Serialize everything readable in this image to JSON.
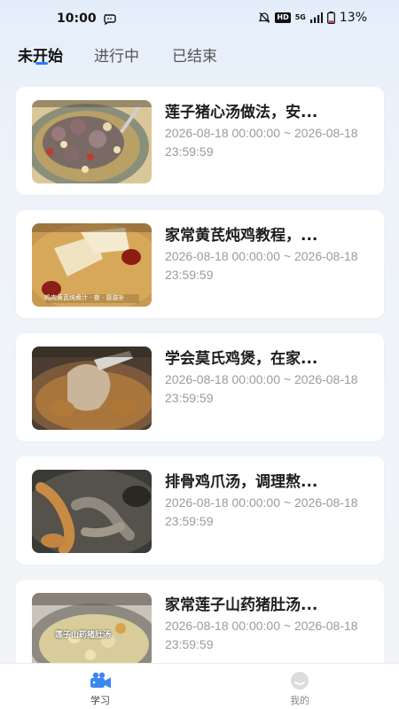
{
  "status_bar": {
    "time": "10:00",
    "battery_percent": "13%",
    "network": "5G",
    "hd_label": "HD"
  },
  "tabs": [
    {
      "label": "未开始",
      "active": true
    },
    {
      "label": "进行中",
      "active": false
    },
    {
      "label": "已结束",
      "active": false
    }
  ],
  "courses": [
    {
      "title": "莲子猪心汤做法，安...",
      "time": "2026-08-18 00:00:00 ~ 2026-08-18 23:59:59",
      "thumb_icon": "lotus-pork-heart-soup-image"
    },
    {
      "title": "家常黄芪炖鸡教程，...",
      "time": "2026-08-18 00:00:00 ~ 2026-08-18 23:59:59",
      "thumb_icon": "astragalus-chicken-image",
      "thumb_caption": "鸡肉黄芪炖煮汁 · 夜 · 感滋补"
    },
    {
      "title": "学会莫氏鸡煲，在家...",
      "time": "2026-08-18 00:00:00 ~ 2026-08-18 23:59:59",
      "thumb_icon": "chicken-pot-image"
    },
    {
      "title": "排骨鸡爪汤，调理熬...",
      "time": "2026-08-18 00:00:00 ~ 2026-08-18 23:59:59",
      "thumb_icon": "ribs-chicken-feet-soup-image"
    },
    {
      "title": "家常莲子山药猪肚汤...",
      "time": "2026-08-18 00:00:00 ~ 2026-08-18 23:59:59",
      "thumb_icon": "lotus-yam-tripe-soup-image",
      "thumb_caption": "莲子山药猪肚汤"
    }
  ],
  "bottom_nav": [
    {
      "label": "学习",
      "icon": "video-camera-icon",
      "active": true
    },
    {
      "label": "我的",
      "icon": "smiley-face-icon",
      "active": false
    }
  ],
  "colors": {
    "accent": "#2b7df5",
    "card": "#ffffff",
    "time_text": "#9b9b9b"
  }
}
